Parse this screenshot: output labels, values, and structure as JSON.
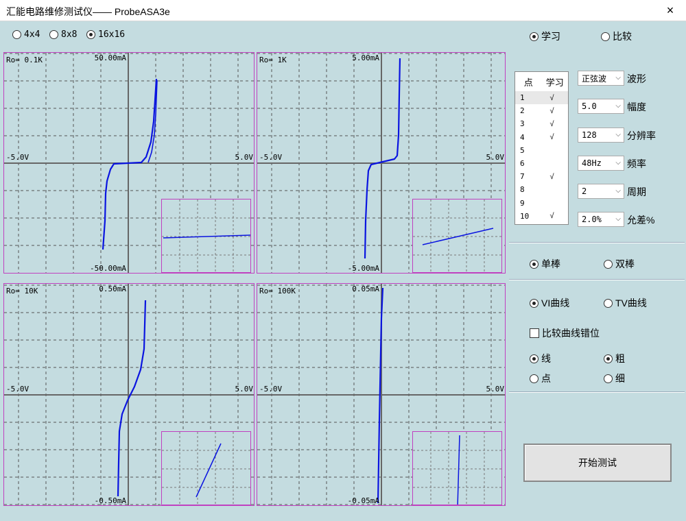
{
  "window": {
    "title": "汇能电路维修测试仪—— ProbeASA3e",
    "close_icon": "×"
  },
  "grid_mode": {
    "options": [
      "4x4",
      "8x8",
      "16x16"
    ],
    "selected": "16x16"
  },
  "mode": {
    "learn": "学习",
    "compare": "比较",
    "selected": "学习"
  },
  "scopes": [
    {
      "ro": "Ro= 0.1K",
      "ytop": "50.00mA",
      "ybot": "-50.00mA",
      "xl": "-5.0V",
      "xr": "5.0V"
    },
    {
      "ro": "Ro= 1K",
      "ytop": "5.00mA",
      "ybot": "-5.00mA",
      "xl": "-5.0V",
      "xr": "5.0V"
    },
    {
      "ro": "Ro= 10K",
      "ytop": "0.50mA",
      "ybot": "-0.50mA",
      "xl": "-5.0V",
      "xr": "5.0V"
    },
    {
      "ro": "Ro= 100K",
      "ytop": "0.05mA",
      "ybot": "-0.05mA",
      "xl": "-5.0V",
      "xr": "5.0V"
    }
  ],
  "point_table": {
    "headers": [
      "点",
      "学习"
    ],
    "rows": [
      {
        "n": "1",
        "mark": "√"
      },
      {
        "n": "2",
        "mark": "√"
      },
      {
        "n": "3",
        "mark": "√"
      },
      {
        "n": "4",
        "mark": "√"
      },
      {
        "n": "5",
        "mark": ""
      },
      {
        "n": "6",
        "mark": ""
      },
      {
        "n": "7",
        "mark": "√"
      },
      {
        "n": "8",
        "mark": ""
      },
      {
        "n": "9",
        "mark": ""
      },
      {
        "n": "10",
        "mark": "√"
      }
    ]
  },
  "settings": [
    {
      "value": "正弦波",
      "label": "波形"
    },
    {
      "value": "5.0",
      "label": "幅度"
    },
    {
      "value": "128",
      "label": "分辨率"
    },
    {
      "value": "48Hz",
      "label": "频率"
    },
    {
      "value": "2",
      "label": "周期"
    },
    {
      "value": "2.0%",
      "label": "允差%"
    }
  ],
  "probe": {
    "single": "单棒",
    "double": "双棒",
    "selected": "单棒"
  },
  "curve_type": {
    "vi": "VI曲线",
    "tv": "TV曲线",
    "selected": "VI曲线"
  },
  "offset_checkbox": {
    "label": "比较曲线错位",
    "checked": false
  },
  "display": {
    "line": "线",
    "dot": "点",
    "thick": "粗",
    "thin": "细",
    "style_selected": "线",
    "width_selected": "粗"
  },
  "start_button": "开始测试",
  "colors": {
    "trace": "#0a14e0",
    "scope_border": "#c040c0",
    "bg": "#c4dce0"
  }
}
